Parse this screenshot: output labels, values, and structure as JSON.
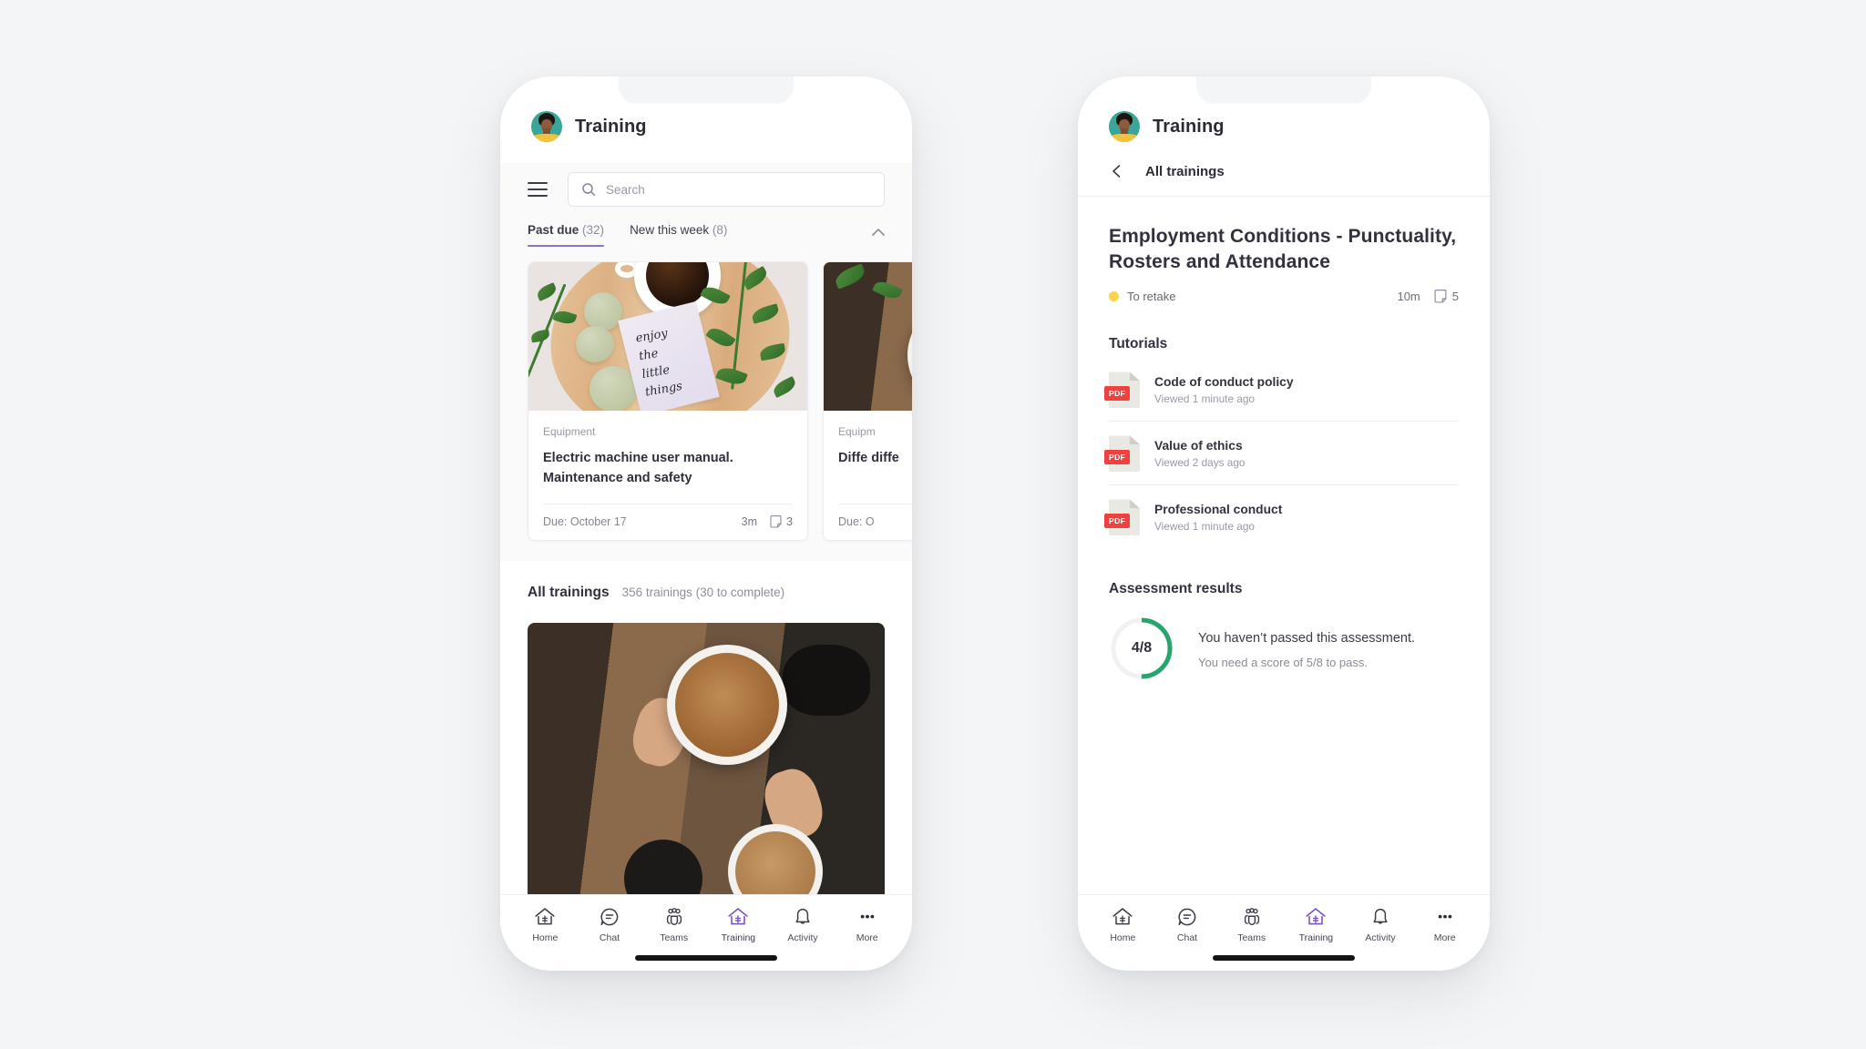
{
  "app": {
    "title": "Training",
    "avatar_name": "user-avatar"
  },
  "left_phone": {
    "menu_icon": "hamburger-icon",
    "search": {
      "placeholder": "Search",
      "icon": "search-icon",
      "value": ""
    },
    "tabs": [
      {
        "label": "Past due",
        "count": "(32)",
        "active": true
      },
      {
        "label": "New this week",
        "count": "(8)",
        "active": false
      }
    ],
    "collapse_icon": "chevron-up-icon",
    "cards": [
      {
        "category": "Equipment",
        "title": "Electric machine user manual. Maintenance and safety",
        "due": "Due: October 17",
        "duration": "3m",
        "pages": "3",
        "pages_icon": "page-icon",
        "image": "coffee-macarons-flatlay-photo",
        "note_text": "enjoy\nthe\nlittle\nthings"
      },
      {
        "category": "Equipm",
        "title": "Diffe diffe",
        "due": "Due: O",
        "duration": "",
        "pages": "",
        "pages_icon": "page-icon",
        "image": "coffee-cup-photo"
      }
    ],
    "all_trainings": {
      "heading": "All trainings",
      "count": "356 trainings (30 to complete)",
      "image": "latte-art-cups-photo"
    }
  },
  "right_phone": {
    "back_icon": "chevron-left-icon",
    "breadcrumb": "All trainings",
    "detail": {
      "title": "Employment Conditions - Punctuality, Rosters and Attendance",
      "status": "To retake",
      "status_color": "#fcd34d",
      "duration": "10m",
      "pages": "5",
      "pages_icon": "page-icon"
    },
    "tutorials": {
      "heading": "Tutorials",
      "items": [
        {
          "name": "Code of conduct policy",
          "meta": "Viewed 1 minute ago",
          "type": "PDF"
        },
        {
          "name": "Value of ethics",
          "meta": "Viewed 2 days ago",
          "type": "PDF"
        },
        {
          "name": "Professional conduct",
          "meta": "Viewed 1 minute ago",
          "type": "PDF"
        }
      ]
    },
    "assessment": {
      "heading": "Assessment results",
      "score": "4/8",
      "score_value": 4,
      "score_total": 8,
      "ring_color": "#28a56c",
      "ring_track_color": "#f1f0f4",
      "message": "You haven’t passed this assessment.",
      "requirement": "You need a score of 5/8 to pass."
    }
  },
  "bottom_nav": {
    "accent_color": "#7b53c1",
    "items": [
      {
        "label": "Home",
        "icon": "home-icon",
        "active": false
      },
      {
        "label": "Chat",
        "icon": "chat-icon",
        "active": false
      },
      {
        "label": "Teams",
        "icon": "teams-icon",
        "active": false
      },
      {
        "label": "Training",
        "icon": "training-home-icon",
        "active": true
      },
      {
        "label": "Activity",
        "icon": "bell-icon",
        "active": false
      },
      {
        "label": "More",
        "icon": "more-ellipsis-icon",
        "active": false
      }
    ]
  }
}
